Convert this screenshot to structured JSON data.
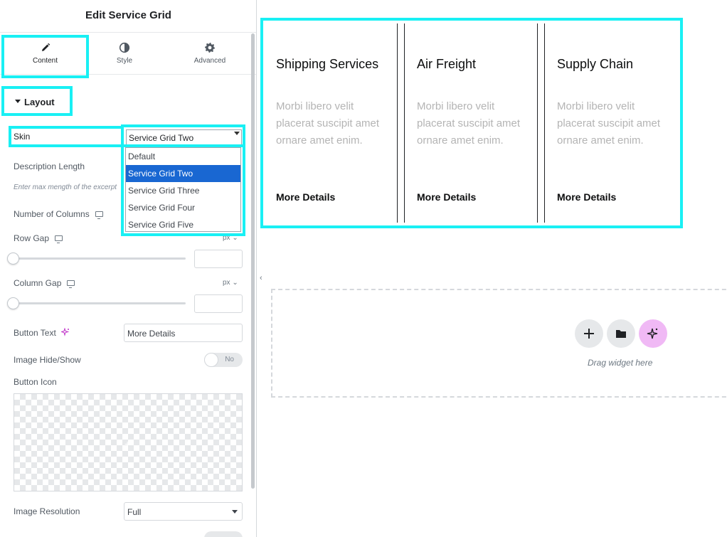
{
  "panel": {
    "title": "Edit Service Grid",
    "tabs": [
      {
        "label": "Content",
        "icon": "pencil-icon"
      },
      {
        "label": "Style",
        "icon": "contrast-icon"
      },
      {
        "label": "Advanced",
        "icon": "gear-icon"
      }
    ],
    "section_title": "Layout",
    "skin": {
      "label": "Skin",
      "value": "Service Grid Two",
      "options": [
        "Default",
        "Service Grid Two",
        "Service Grid Three",
        "Service Grid Four",
        "Service Grid Five"
      ]
    },
    "description_length": {
      "label": "Description Length",
      "hint": "Enter max mength of the excerpt"
    },
    "number_of_columns": {
      "label": "Number of Columns"
    },
    "row_gap": {
      "label": "Row Gap",
      "unit": "px"
    },
    "column_gap": {
      "label": "Column Gap",
      "unit": "px"
    },
    "button_text": {
      "label": "Button Text",
      "value": "More Details"
    },
    "image_hide_show": {
      "label": "Image Hide/Show",
      "toggle": "No"
    },
    "button_icon": {
      "label": "Button Icon"
    },
    "image_resolution": {
      "label": "Image Resolution",
      "value": "Full"
    }
  },
  "canvas": {
    "services": [
      {
        "title": "Shipping Services",
        "description": "Morbi libero velit placerat suscipit amet ornare amet enim.",
        "link": "More Details"
      },
      {
        "title": "Air Freight",
        "description": "Morbi libero velit placerat suscipit amet ornare amet enim.",
        "link": "More Details"
      },
      {
        "title": "Supply Chain",
        "description": "Morbi libero velit placerat suscipit amet ornare amet enim.",
        "link": "More Details"
      }
    ],
    "drop_text": "Drag widget here"
  },
  "colors": {
    "highlight": "#19f0f4",
    "selected_option": "#1967d2",
    "ai_button": "#f0b9f5"
  }
}
